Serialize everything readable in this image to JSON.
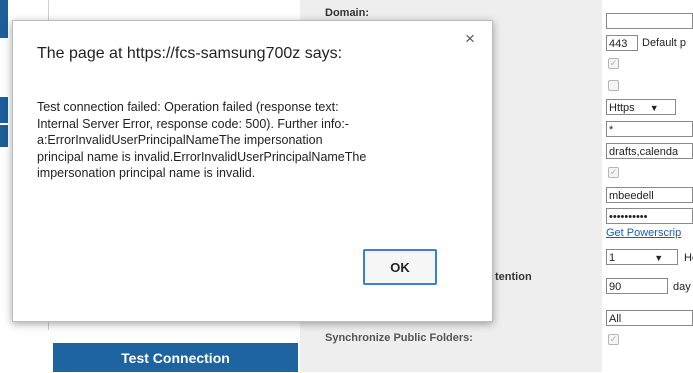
{
  "dialog": {
    "title": "The page at https://fcs-samsung700z says:",
    "message": "Test connection failed: Operation failed (response text: \nInternal Server Error, response code: 500). Further info:-\n  a:ErrorInvalidUserPrincipalNameThe impersonation \nprincipal name is invalid.ErrorInvalidUserPrincipalNameThe \nimpersonation principal name is invalid.",
    "close_glyph": "×",
    "ok_label": "OK"
  },
  "background": {
    "domain_label": "Domain:",
    "port_value": "443",
    "port_default_text": "Default p",
    "protocol_value": "Https",
    "protocol_arrow": "▼",
    "asterisk_value": "*",
    "folders_value": "drafts,calenda",
    "username_value": "mbeedell",
    "password_value": "••••••••••",
    "powershell_link": "Get Powerscrip",
    "hours_value": "1",
    "hours_arrow": "▼",
    "hours_unit": "Ho",
    "retention_label_fragment": "tention",
    "days_value": "90",
    "days_unit": "day",
    "all_value": "All",
    "public_folders_label": "Synchronize Public Folders:",
    "test_connection_label": "Test Connection"
  }
}
